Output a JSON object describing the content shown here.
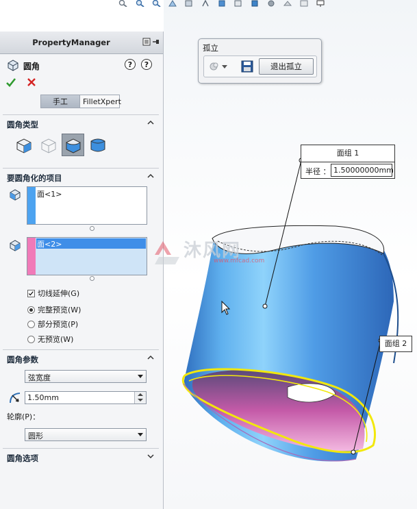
{
  "toolbar": {
    "icons": [
      "zoom-to-fit-icon",
      "zoom-area-icon",
      "previous-view-icon",
      "section-view-icon",
      "view-orientation-icon",
      "display-style-icon",
      "hide-show-icon",
      "edit-appearance-icon",
      "apply-scene-icon",
      "view-settings-icon",
      "monitor-icon"
    ]
  },
  "panel": {
    "header_title": "PropertyManager",
    "feature_name": "圆角",
    "mode_tabs": [
      "手工",
      "FilletXpert"
    ],
    "sections": {
      "fillet_type": "圆角类型",
      "items_to_fillet": "要圆角化的项目",
      "fillet_params": "圆角参数",
      "fillet_options": "圆角选项"
    },
    "selection1_item": "面<1>",
    "selection2_item": "面<2>",
    "tangent_propagation": "切线延伸(G)",
    "preview_options": [
      "完整预览(W)",
      "部分预览(P)",
      "无预览(W)"
    ],
    "preview_selected": 0,
    "chord_method": "弦宽度",
    "distance_value": "1.50mm",
    "profile_label": "轮廓(P)：",
    "profile_value": "圆形"
  },
  "isolate": {
    "title": "孤立",
    "exit_label": "退出孤立"
  },
  "callouts": {
    "face_set1_title": "面组 1",
    "radius_label": "半径 ：",
    "radius_value": "1.50000000mm",
    "face_set2_title": "面组 2"
  },
  "watermark": {
    "text": "沐风网",
    "url": "www.mfcad.com"
  },
  "colors": {
    "accent_blue": "#3f8ee8",
    "stripe_blue": "#4da3f0",
    "stripe_pink": "#f07ab8",
    "preview_yellow": "#f2e80c"
  }
}
